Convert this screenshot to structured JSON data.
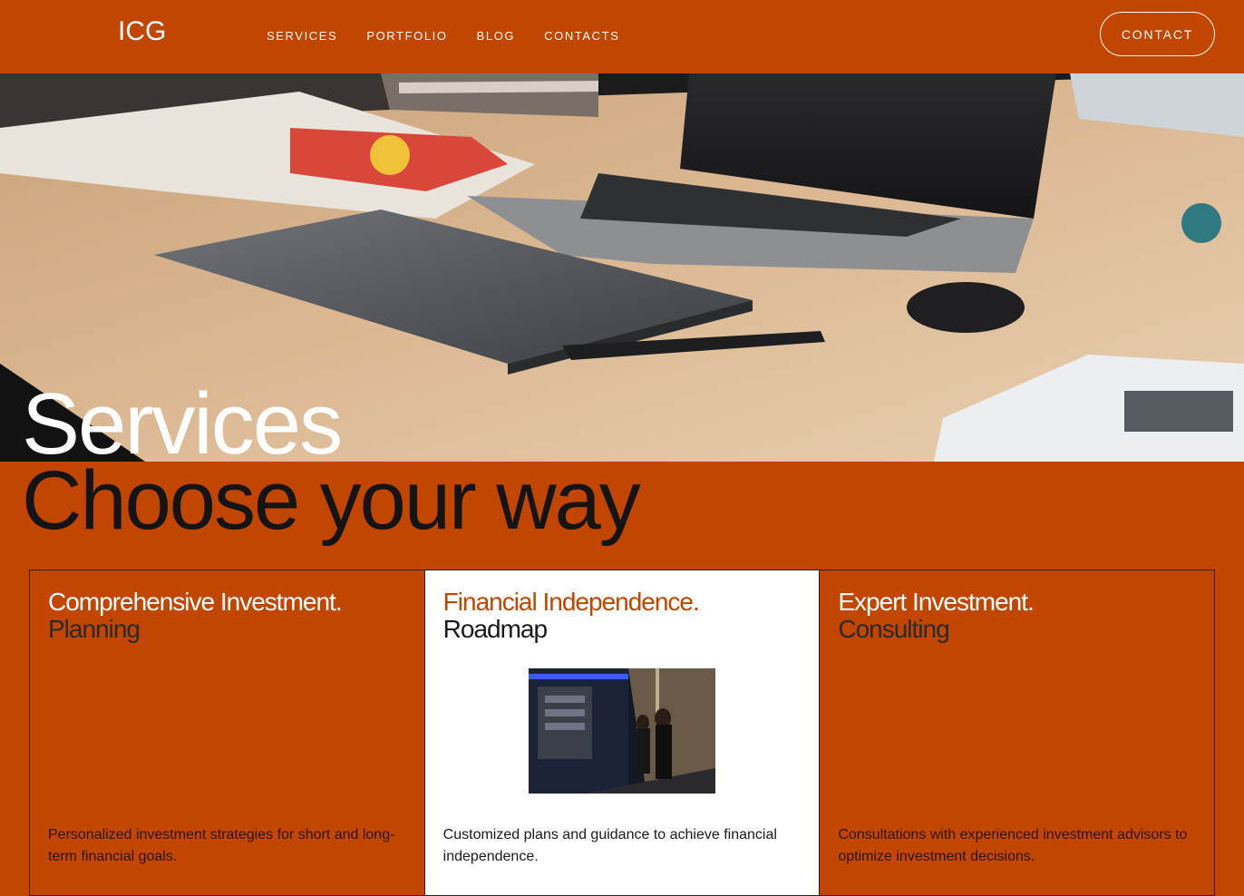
{
  "header": {
    "logo": "ICG",
    "nav": [
      "SERVICES",
      "PORTFOLIO",
      "BLOG",
      "CONTACTS"
    ],
    "cta": "CONTACT"
  },
  "hero": {
    "title": "Services",
    "subtitle": "Choose your way"
  },
  "cards": [
    {
      "title_line1": "Comprehensive Investment.",
      "title_line2": "Planning",
      "description": "Personalized investment strategies for short and long-term financial goals.",
      "active": false
    },
    {
      "title_line1": "Financial Independence.",
      "title_line2": "Roadmap",
      "description": "Customized plans and guidance to achieve financial independence.",
      "active": true
    },
    {
      "title_line1": "Expert Investment.",
      "title_line2": "Consulting",
      "description": "Consultations with experienced investment advisors to optimize investment decisions.",
      "active": false
    }
  ],
  "colors": {
    "brand": "#C24600",
    "text_dark": "#141414",
    "white": "#ffffff"
  }
}
